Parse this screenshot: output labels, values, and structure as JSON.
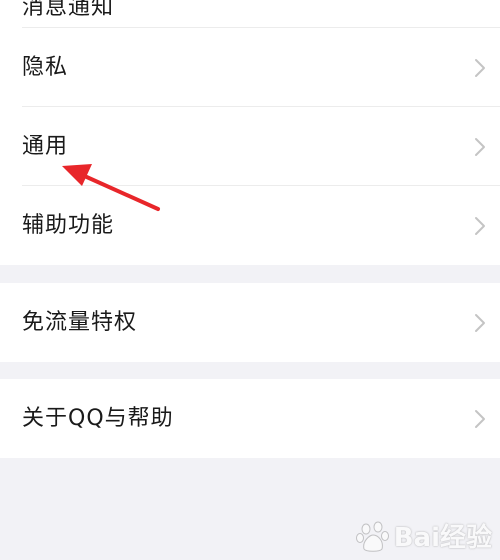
{
  "menu": {
    "cut_off_label": "消息通知",
    "items": [
      {
        "label": "隐私"
      },
      {
        "label": "通用"
      },
      {
        "label": "辅助功能"
      },
      {
        "label": "免流量特权"
      },
      {
        "label": "关于QQ与帮助"
      }
    ]
  },
  "annotation": {
    "arrow_color": "#e8262a",
    "points_to": "通用"
  },
  "watermark": {
    "text": "Bai经验"
  },
  "icons": {
    "chevron": "chevron-right-icon"
  },
  "colors": {
    "background": "#f2f2f6",
    "card": "#ffffff",
    "text": "#1a1a1a",
    "chevron": "#c4c4c4"
  }
}
